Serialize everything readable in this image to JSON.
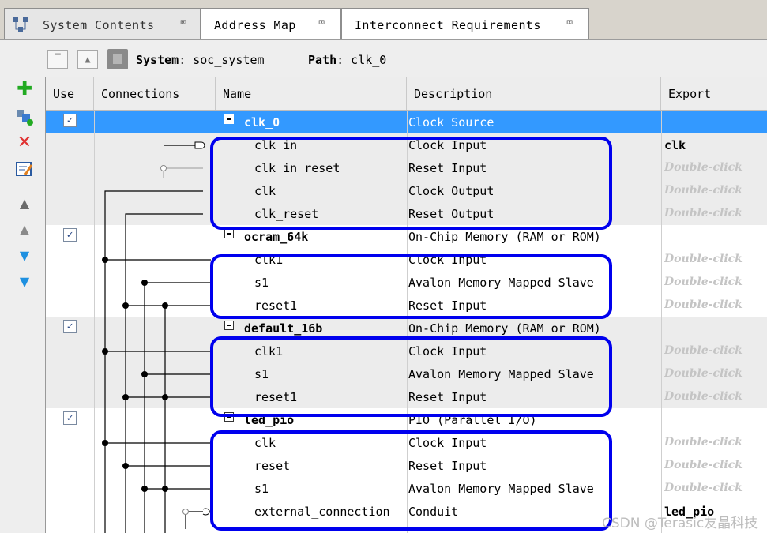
{
  "tabs": [
    {
      "label": "System Contents",
      "close": "⌧"
    },
    {
      "label": "Address Map",
      "close": "⌧"
    },
    {
      "label": "Interconnect Requirements",
      "close": "⌧"
    }
  ],
  "pathbar": {
    "system_label": "System",
    "system_value": ": soc_system",
    "path_label": "Path",
    "path_value": ": clk_0"
  },
  "toolbar_icons": [
    "add-icon",
    "add-connection-icon",
    "remove-icon",
    "edit-icon",
    "move-top-icon",
    "move-up-icon",
    "move-down-icon",
    "move-bottom-icon"
  ],
  "columns": [
    "Use",
    "Connections",
    "Name",
    "Description",
    "Export"
  ],
  "rows": [
    {
      "type": "component",
      "checked": true,
      "name": "clk_0",
      "description": "Clock Source",
      "export": ""
    },
    {
      "type": "port",
      "name": "clk_in",
      "description": "Clock Input",
      "export": "clk"
    },
    {
      "type": "port",
      "name": "clk_in_reset",
      "description": "Reset Input",
      "export": "Double-click"
    },
    {
      "type": "port",
      "name": "clk",
      "description": "Clock Output",
      "export": "Double-click"
    },
    {
      "type": "port",
      "name": "clk_reset",
      "description": "Reset Output",
      "export": "Double-click"
    },
    {
      "type": "component",
      "checked": true,
      "name": "ocram_64k",
      "description": "On-Chip Memory (RAM or ROM)",
      "export": ""
    },
    {
      "type": "port",
      "name": "clk1",
      "description": "Clock Input",
      "export": "Double-click"
    },
    {
      "type": "port",
      "name": "s1",
      "description": "Avalon Memory Mapped Slave",
      "export": "Double-click"
    },
    {
      "type": "port",
      "name": "reset1",
      "description": "Reset Input",
      "export": "Double-click"
    },
    {
      "type": "component",
      "checked": true,
      "name": "default_16b",
      "description": "On-Chip Memory (RAM or ROM)",
      "export": ""
    },
    {
      "type": "port",
      "name": "clk1",
      "description": "Clock Input",
      "export": "Double-click"
    },
    {
      "type": "port",
      "name": "s1",
      "description": "Avalon Memory Mapped Slave",
      "export": "Double-click"
    },
    {
      "type": "port",
      "name": "reset1",
      "description": "Reset Input",
      "export": "Double-click"
    },
    {
      "type": "component",
      "checked": true,
      "name": "led_pio",
      "description": "PIO (Parallel I/O)",
      "export": ""
    },
    {
      "type": "port",
      "name": "clk",
      "description": "Clock Input",
      "export": "Double-click"
    },
    {
      "type": "port",
      "name": "reset",
      "description": "Reset Input",
      "export": "Double-click"
    },
    {
      "type": "port",
      "name": "s1",
      "description": "Avalon Memory Mapped Slave",
      "export": "Double-click"
    },
    {
      "type": "port",
      "name": "external_connection",
      "description": "Conduit",
      "export": "led_pio"
    }
  ],
  "colors": {
    "selection": "#3399ff",
    "highlight_box": "#0000ee"
  },
  "watermark": "CSDN @Terasic友晶科技"
}
